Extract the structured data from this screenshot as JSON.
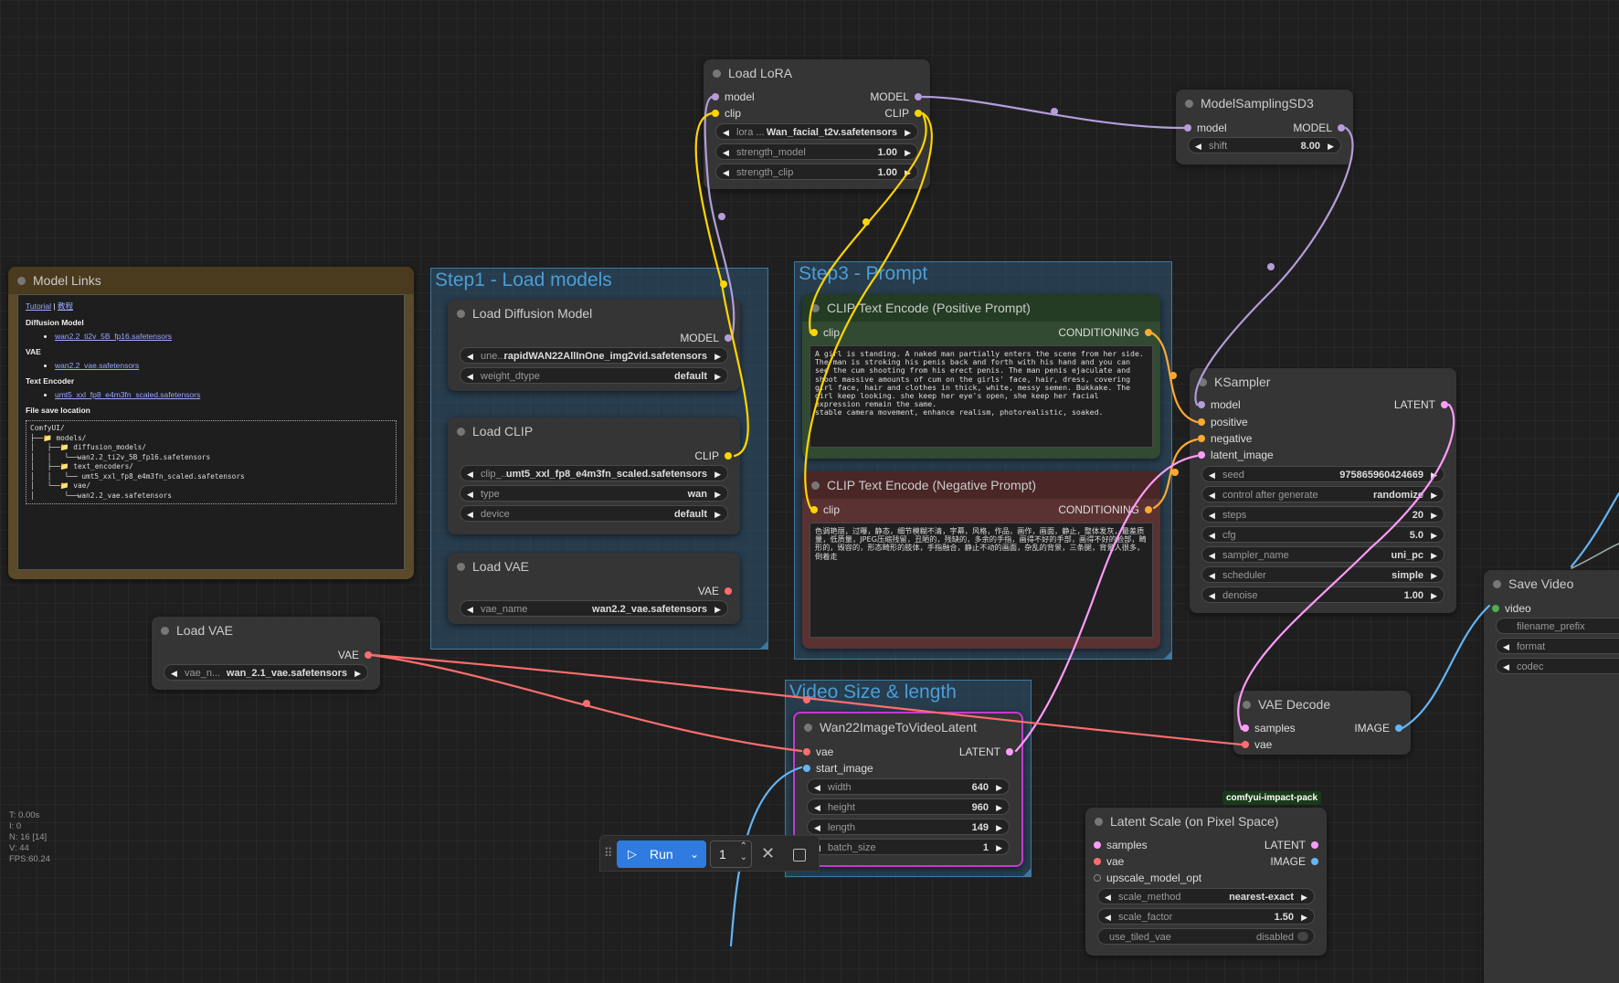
{
  "groups": {
    "step1": "Step1 - Load models",
    "step3": "Step3 - Prompt",
    "video_size": "Video Size & length"
  },
  "model_links": {
    "title": "Model Links",
    "tutorial_link": "Tutorial",
    "separator": " | ",
    "tutorial_link_cn": "教程",
    "diffusion_heading": "Diffusion Model",
    "diffusion_file": "wan2.2_ti2v_5B_fp16.safetensors",
    "vae_heading": "VAE",
    "vae_file": "wan2.2_vae.safetensors",
    "text_encoder_heading": "Text Encoder",
    "text_encoder_file": "umt5_xxl_fp8_e4m3fn_scaled.safetensors",
    "save_heading": "File save location",
    "tree": "ComfyUI/\n├──📁 models/\n│   ├──📁 diffusion_models/\n│   │   └──wan2.2_ti2v_5B_fp16.safetensors\n│   ├──📁 text_encoders/\n│   │   └── umt5_xxl_fp8_e4m3fn_scaled.safetensors\n│   └──📁 vae/\n│       └──wan2.2_vae.safetensors"
  },
  "load_lora": {
    "title": "Load LoRA",
    "in_model": "model",
    "in_clip": "clip",
    "out_model": "MODEL",
    "out_clip": "CLIP",
    "w_lora_label": "lora ...",
    "w_lora_value": "Wan_facial_t2v.safetensors",
    "w_strength_model_label": "strength_model",
    "w_strength_model_value": "1.00",
    "w_strength_clip_label": "strength_clip",
    "w_strength_clip_value": "1.00"
  },
  "model_sampling": {
    "title": "ModelSamplingSD3",
    "in_model": "model",
    "out_model": "MODEL",
    "w_shift_label": "shift",
    "w_shift_value": "8.00"
  },
  "load_diffusion": {
    "title": "Load Diffusion Model",
    "out_model": "MODEL",
    "w_unet_label": "une...",
    "w_unet_value": "rapidWAN22AllInOne_img2vid.safetensors",
    "w_dtype_label": "weight_dtype",
    "w_dtype_value": "default"
  },
  "load_clip": {
    "title": "Load CLIP",
    "out_clip": "CLIP",
    "w_clip_label": "clip_...",
    "w_clip_value": "umt5_xxl_fp8_e4m3fn_scaled.safetensors",
    "w_type_label": "type",
    "w_type_value": "wan",
    "w_device_label": "device",
    "w_device_value": "default"
  },
  "load_vae_inner": {
    "title": "Load VAE",
    "out_vae": "VAE",
    "w_vae_label": "vae_name",
    "w_vae_value": "wan2.2_vae.safetensors"
  },
  "load_vae_outer": {
    "title": "Load VAE",
    "out_vae": "VAE",
    "w_vae_label": "vae_n...",
    "w_vae_value": "wan_2.1_vae.safetensors"
  },
  "clip_positive": {
    "title": "CLIP Text Encode (Positive Prompt)",
    "in_clip": "clip",
    "out_cond": "CONDITIONING",
    "text": "A girl is standing. A naked man partially enters the scene from her side. The man is stroking his penis back and forth with his hand and you can see the cum shooting from his erect penis. The man penis ejaculate and shoot massive amounts of cum on the girls' face, hair, dress, covering girl face, hair and clothes in thick, white, messy semen. Bukkake. The girl keep looking. she keep her eye's open, she keep her facial expression remain the same.\nstable camera movement, enhance realism, photorealistic, soaked."
  },
  "clip_negative": {
    "title": "CLIP Text Encode (Negative Prompt)",
    "in_clip": "clip",
    "out_cond": "CONDITIONING",
    "text": "色调艳丽，过曝，静态，细节模糊不清，字幕，风格，作品，画作，画面，静止，整体发灰，最差质量，低质量，JPEG压缩残留，丑陋的，残缺的，多余的手指，画得不好的手部，画得不好的脸部，畸形的，毁容的，形态畸形的肢体，手指融合，静止不动的画面，杂乱的背景，三条腿，背景人很多，倒着走"
  },
  "ksampler": {
    "title": "KSampler",
    "in_model": "model",
    "in_positive": "positive",
    "in_negative": "negative",
    "in_latent": "latent_image",
    "out_latent": "LATENT",
    "w_seed_label": "seed",
    "w_seed_value": "975865960424669",
    "w_control_label": "control after generate",
    "w_control_value": "randomize",
    "w_steps_label": "steps",
    "w_steps_value": "20",
    "w_cfg_label": "cfg",
    "w_cfg_value": "5.0",
    "w_sampler_label": "sampler_name",
    "w_sampler_value": "uni_pc",
    "w_scheduler_label": "scheduler",
    "w_scheduler_value": "simple",
    "w_denoise_label": "denoise",
    "w_denoise_value": "1.00"
  },
  "save_video": {
    "title": "Save Video",
    "in_video": "video",
    "w_prefix_label": "filename_prefix",
    "w_format_label": "format",
    "w_codec_label": "codec"
  },
  "vae_decode": {
    "title": "VAE Decode",
    "in_samples": "samples",
    "in_vae": "vae",
    "out_image": "IMAGE"
  },
  "wan_latent": {
    "title": "Wan22ImageToVideoLatent",
    "in_vae": "vae",
    "in_start": "start_image",
    "out_latent": "LATENT",
    "w_width_label": "width",
    "w_width_value": "640",
    "w_height_label": "height",
    "w_height_value": "960",
    "w_length_label": "length",
    "w_length_value": "149",
    "w_batch_label": "batch_size",
    "w_batch_value": "1"
  },
  "latent_scale": {
    "badge": "comfyui-impact-pack",
    "title": "Latent Scale (on Pixel Space)",
    "in_samples": "samples",
    "in_vae": "vae",
    "in_upscale": "upscale_model_opt",
    "out_latent": "LATENT",
    "out_image": "IMAGE",
    "w_method_label": "scale_method",
    "w_method_value": "nearest-exact",
    "w_factor_label": "scale_factor",
    "w_factor_value": "1.50",
    "w_tiled_label": "use_tiled_vae",
    "w_tiled_value": "disabled"
  },
  "hud": {
    "t": "T: 0.00s",
    "i": "I: 0",
    "n": "N: 16 [14]",
    "v": "V: 44",
    "fps": "FPS:60.24"
  },
  "toolbar": {
    "run_label": "Run",
    "queue_count": "1"
  },
  "colors": {
    "clip": "#ffd500",
    "model": "#b39ddb",
    "vae": "#ff6e6e",
    "latent": "#ff9cf9",
    "image": "#64b5f6",
    "conditioning": "#ffa931",
    "video": "#4caf50",
    "run_button": "#2f7be0"
  }
}
